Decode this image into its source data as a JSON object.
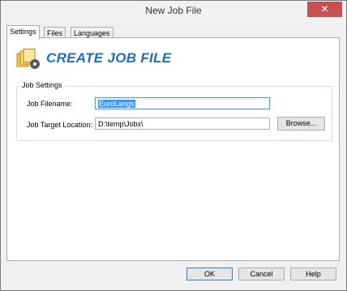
{
  "window": {
    "title": "New Job File",
    "close_glyph": "✕"
  },
  "tabs": [
    {
      "label": "Settings"
    },
    {
      "label": "Files"
    },
    {
      "label": "Languages"
    }
  ],
  "header": {
    "title": "CREATE JOB FILE",
    "icon": "job-file-icon",
    "accent": "#1f6fb7"
  },
  "job_settings": {
    "group_label": "Job Settings",
    "filename_label": "Job Filename:",
    "filename_value": "EuroLangs",
    "target_label": "Job Target Location:",
    "target_value": "D:\\temp\\Jobx\\",
    "browse_label": "Browse..."
  },
  "footer": {
    "ok_label": "OK",
    "cancel_label": "Cancel",
    "help_label": "Help"
  }
}
